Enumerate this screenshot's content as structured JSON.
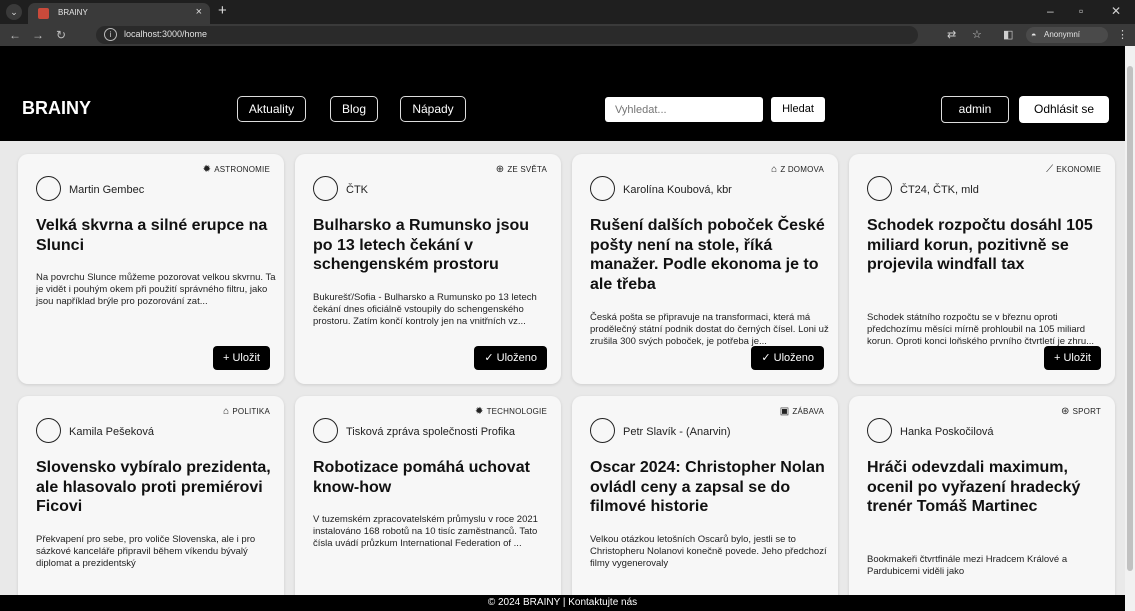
{
  "browser": {
    "tab_title": "BRAINY",
    "tab_close": "×",
    "new_tab": "+",
    "url": "localhost:3000/home",
    "anonymous_label": "Anonymní"
  },
  "header": {
    "brand": "BRAINY",
    "nav": [
      "Aktuality",
      "Blog",
      "Nápady"
    ],
    "search_placeholder": "Vyhledat...",
    "search_button": "Hledat",
    "user_button": "admin",
    "logout_button": "Odhlásit se"
  },
  "articles": [
    {
      "category": "ASTRONOMIE",
      "category_icon": "gear-icon",
      "author": "Martin Gembec",
      "title": "Velká skvrna a silné erupce na Slunci",
      "excerpt": "Na povrchu Slunce můžeme pozorovat velkou skvrnu. Ta je vidět i pouhým okem při použití správného filtru, jako jsou například brýle pro pozorování zat...",
      "save_label": "+ Uložit"
    },
    {
      "category": "ZE SVĚTA",
      "category_icon": "globe-icon",
      "author": "ČTK",
      "title": "Bulharsko a Rumunsko jsou po 13 letech čekání v schengenském prostoru",
      "excerpt": "Bukurešť/Sofia - Bulharsko a Rumunsko po 13 letech čekání dnes oficiálně vstoupily do schengenského prostoru. Zatím končí kontroly jen na vnitřních vz...",
      "save_label": "✓ Uloženo"
    },
    {
      "category": "Z DOMOVA",
      "category_icon": "home-icon",
      "author": "Karolína Koubová, kbr",
      "title": "Rušení dalších poboček České pošty není na stole, říká manažer. Podle ekonoma je to ale třeba",
      "excerpt": "Česká pošta se připravuje na transformaci, která má prodělečný státní podnik dostat do černých čísel. Loni už zrušila 300 svých poboček, je potřeba je...",
      "save_label": "✓ Uloženo"
    },
    {
      "category": "EKONOMIE",
      "category_icon": "chart-line-icon",
      "author": "ČT24, ČTK, mld",
      "title": "Schodek rozpočtu dosáhl 105 miliard korun, pozitivně se projevila windfall tax",
      "excerpt": "Schodek státního rozpočtu se v březnu oproti předchozímu měsíci mírně prohloubil na 105 miliard korun. Oproti konci loňského prvního čtvrtletí je zhru...",
      "save_label": "+ Uložit"
    },
    {
      "category": "POLITIKA",
      "category_icon": "landmark-icon",
      "author": "Kamila Pešeková",
      "title": "Slovensko vybíralo prezidenta, ale hlasovalo proti premiérovi Ficovi",
      "excerpt": "Překvapení pro sebe, pro voliče Slovenska, ale i pro sázkové kanceláře připravil během víkendu bývalý diplomat a prezidentský",
      "save_label": ""
    },
    {
      "category": "TECHNOLOGIE",
      "category_icon": "gear-icon",
      "author": "Tisková zpráva společnosti Profika",
      "title": "Robotizace pomáhá uchovat know-how",
      "excerpt": "V tuzemském zpracovatelském průmyslu v roce 2021 instalováno 168 robotů na 10 tisíc zaměstnanců. Tato čísla uvádí průzkum International Federation of ...",
      "save_label": ""
    },
    {
      "category": "ZÁBAVA",
      "category_icon": "film-icon",
      "author": "Petr Slavík - (Anarvin)",
      "title": "Oscar 2024: Christopher Nolan ovládl ceny a zapsal se do filmové historie",
      "excerpt": "Velkou otázkou letošních Oscarů bylo, jestli se to Christopheru Nolanovi konečně povede. Jeho předchozí filmy vygenerovaly",
      "save_label": ""
    },
    {
      "category": "SPORT",
      "category_icon": "ball-icon",
      "author": "Hanka Poskočilová",
      "title": "Hráči odevzdali maximum, ocenil po vyřazení hradecký trenér Tomáš Martinec",
      "excerpt": "Bookmakeři čtvrtfinále mezi Hradcem Králové a Pardubicemi viděli jako",
      "save_label": ""
    }
  ],
  "footer": "© 2024 BRAINY | Kontaktujte nás"
}
